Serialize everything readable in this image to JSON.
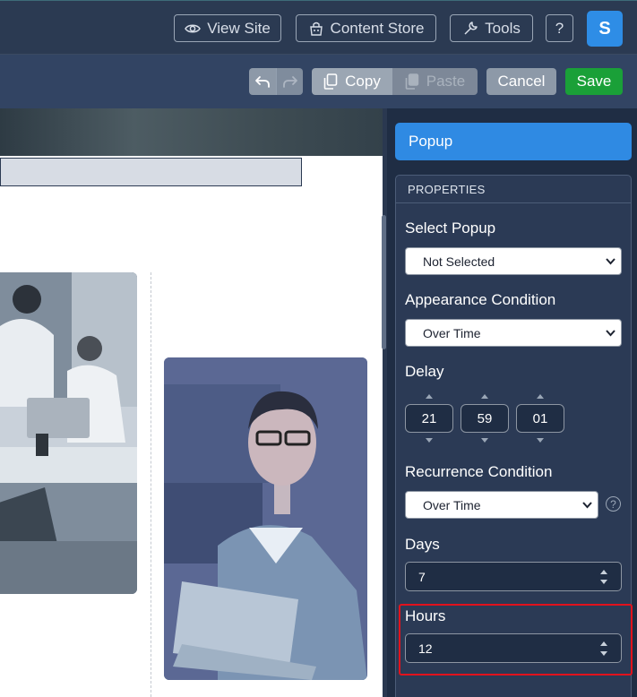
{
  "topbar": {
    "view_site": "View Site",
    "content_store": "Content Store",
    "tools": "Tools",
    "help": "?",
    "avatar": "S",
    "icons": [
      "eye-icon",
      "content-store-icon",
      "wrench-icon"
    ]
  },
  "toolbar": {
    "copy": "Copy",
    "paste": "Paste",
    "cancel": "Cancel",
    "save": "Save"
  },
  "panel": {
    "tab": "Popup",
    "section": "PROPERTIES",
    "select_popup": {
      "label": "Select Popup",
      "value": "Not Selected"
    },
    "appearance": {
      "label": "Appearance Condition",
      "value": "Over Time"
    },
    "delay": {
      "label": "Delay",
      "hours": "21",
      "minutes": "59",
      "seconds": "01"
    },
    "recurrence": {
      "label": "Recurrence Condition",
      "value": "Over Time"
    },
    "days": {
      "label": "Days",
      "value": "7"
    },
    "hours": {
      "label": "Hours",
      "value": "12"
    }
  },
  "colors": {
    "accent": "#2f8ae3",
    "save": "#1aa038",
    "highlight": "#e2121c"
  }
}
